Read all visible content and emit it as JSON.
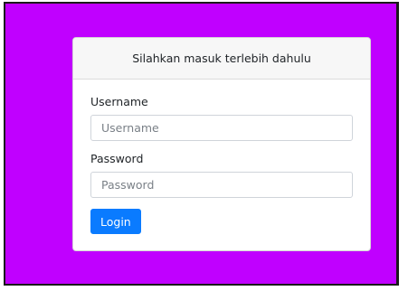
{
  "login_card": {
    "header_title": "Silahkan masuk terlebih dahulu",
    "username": {
      "label": "Username",
      "placeholder": "Username",
      "value": ""
    },
    "password": {
      "label": "Password",
      "placeholder": "Password",
      "value": ""
    },
    "login_label": "Login"
  },
  "colors": {
    "page_background": "#c000ff",
    "button_primary": "#0a7bff",
    "card_header": "#f7f7f7"
  }
}
